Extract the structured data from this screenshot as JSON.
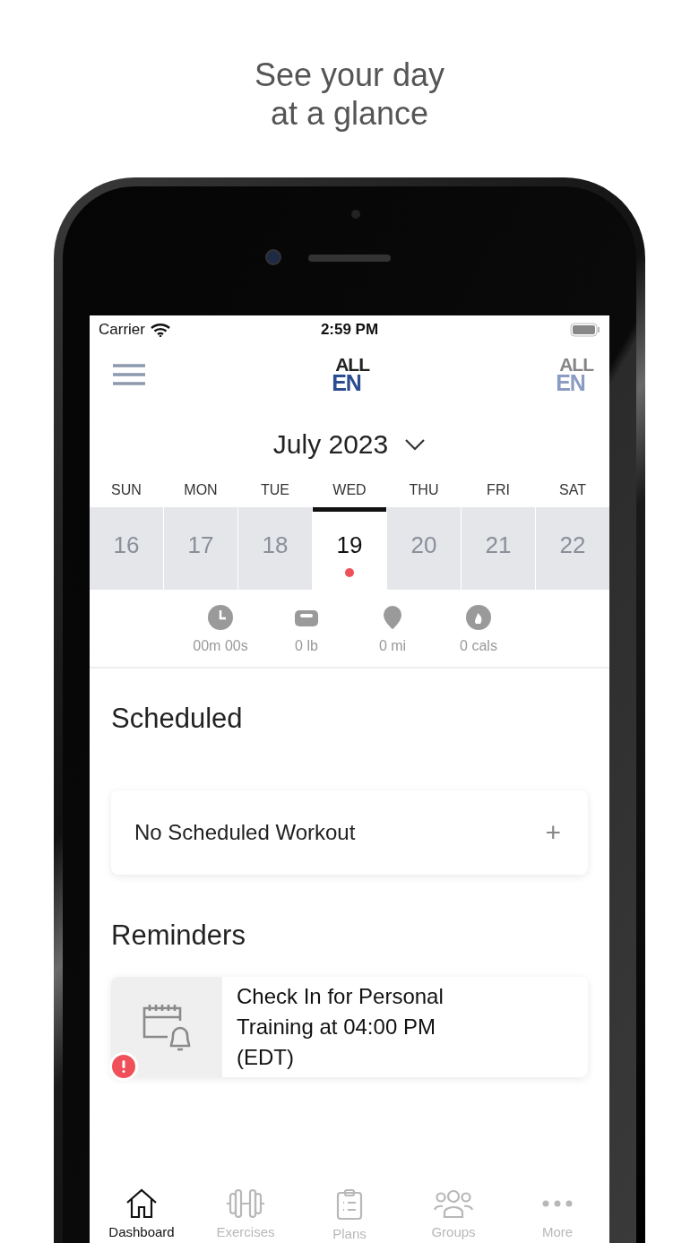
{
  "headline": [
    "See your day",
    "at a glance"
  ],
  "status_bar": {
    "carrier": "Carrier",
    "time": "2:59 PM"
  },
  "header": {
    "logo": [
      "ALL",
      "EN"
    ],
    "profile_logo": [
      "ALL",
      "EN"
    ]
  },
  "month": {
    "label": "July 2023"
  },
  "week": [
    {
      "day": "SUN",
      "date": "16",
      "selected": false,
      "has_event": false
    },
    {
      "day": "MON",
      "date": "17",
      "selected": false,
      "has_event": false
    },
    {
      "day": "TUE",
      "date": "18",
      "selected": false,
      "has_event": false
    },
    {
      "day": "WED",
      "date": "19",
      "selected": true,
      "has_event": true
    },
    {
      "day": "THU",
      "date": "20",
      "selected": false,
      "has_event": false
    },
    {
      "day": "FRI",
      "date": "21",
      "selected": false,
      "has_event": false
    },
    {
      "day": "SAT",
      "date": "22",
      "selected": false,
      "has_event": false
    }
  ],
  "stats": [
    {
      "kind": "time",
      "reading": "00m 00s"
    },
    {
      "kind": "weight",
      "reading": "0 lb"
    },
    {
      "kind": "distance",
      "reading": "0 mi"
    },
    {
      "kind": "calories",
      "reading": "0 cals"
    }
  ],
  "scheduled": {
    "title": "Scheduled",
    "empty_text": "No Scheduled Workout",
    "add_symbol": "+"
  },
  "reminders": {
    "title": "Reminders",
    "items": [
      {
        "text": "Check In for Personal Training at 04:00 PM (EDT)",
        "alert": true
      }
    ]
  },
  "tabs": [
    {
      "kind": "home",
      "label": "Dashboard",
      "selected": true
    },
    {
      "kind": "dumbbell",
      "label": "Exercises",
      "selected": false
    },
    {
      "kind": "clipboard",
      "label": "Plans",
      "selected": false
    },
    {
      "kind": "people",
      "label": "Groups",
      "selected": false
    },
    {
      "kind": "more",
      "label": "More",
      "selected": false
    }
  ]
}
